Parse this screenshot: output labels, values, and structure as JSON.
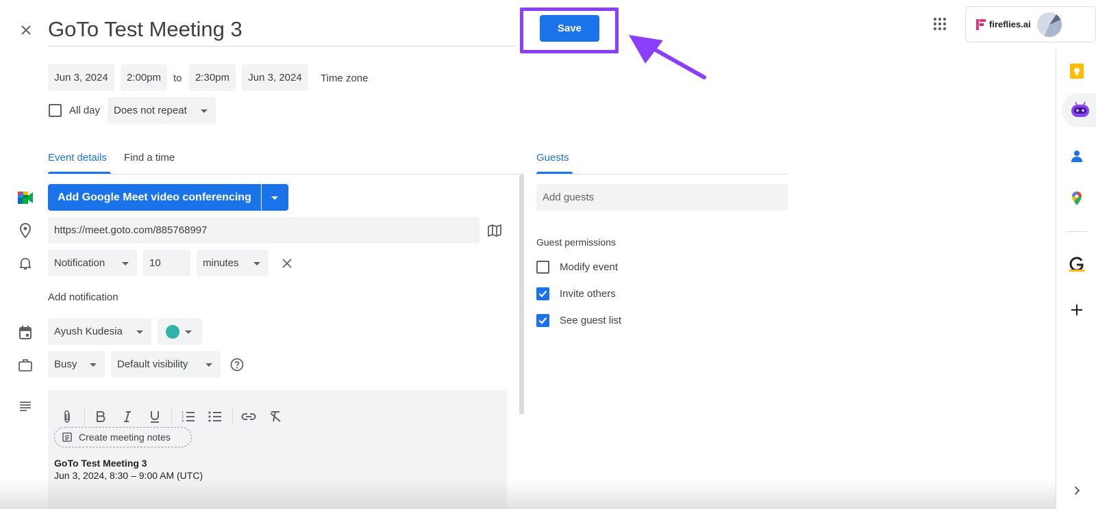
{
  "header": {
    "title": "GoTo Test Meeting 3",
    "save_label": "Save"
  },
  "datetime": {
    "start_date": "Jun 3, 2024",
    "start_time": "2:00pm",
    "to_label": "to",
    "end_time": "2:30pm",
    "end_date": "Jun 3, 2024",
    "time_zone_label": "Time zone",
    "all_day_label": "All day",
    "repeat_value": "Does not repeat"
  },
  "tabs": {
    "event_details": "Event details",
    "find_a_time": "Find a time",
    "guests": "Guests"
  },
  "details": {
    "meet_button_label": "Add Google Meet video conferencing",
    "location_value": "https://meet.goto.com/885768997",
    "notification_type": "Notification",
    "notification_amount": "10",
    "notification_unit": "minutes",
    "add_notification_label": "Add notification",
    "calendar_owner": "Ayush Kudesia",
    "calendar_color": "#33b2a8",
    "busy_value": "Busy",
    "visibility_value": "Default visibility",
    "create_notes_label": "Create meeting notes",
    "description_title": "GoTo Test Meeting 3",
    "description_line": "Jun 3, 2024, 8:30 – 9:00 AM (UTC)"
  },
  "guests": {
    "add_guests_placeholder": "Add guests",
    "permissions_label": "Guest permissions",
    "permissions": [
      {
        "label": "Modify event",
        "checked": false
      },
      {
        "label": "Invite others",
        "checked": true
      },
      {
        "label": "See guest list",
        "checked": true
      }
    ]
  },
  "topbar": {
    "brand_name": "fireflies.ai"
  },
  "colors": {
    "primary": "#1a73e8",
    "annotation": "#8a3ffc",
    "chip_bg": "#f1f3f4"
  }
}
